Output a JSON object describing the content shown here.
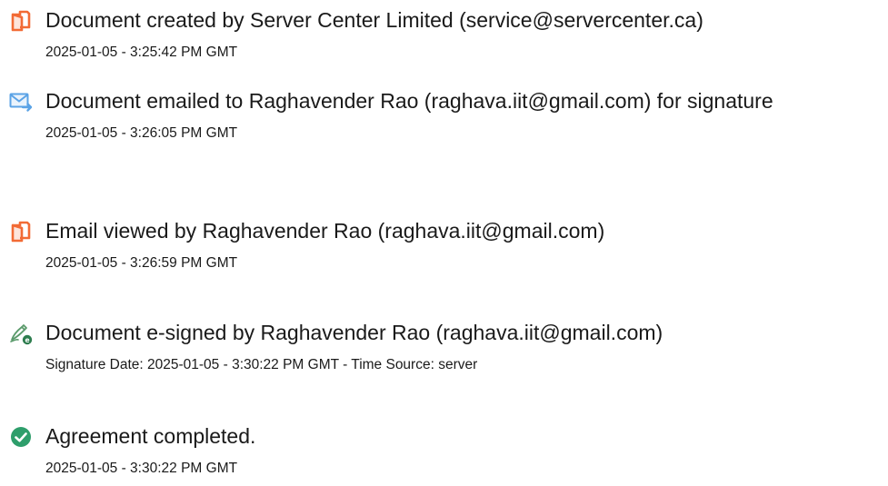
{
  "audit_trail": {
    "events": [
      {
        "icon": "document-created-icon",
        "title": "Document created by Server Center Limited (service@servercenter.ca)",
        "time": "2025-01-05 - 3:25:42 PM GMT"
      },
      {
        "icon": "email-sent-icon",
        "title": "Document emailed to Raghavender Rao (raghava.iit@gmail.com) for signature",
        "time": "2025-01-05 - 3:26:05 PM GMT"
      },
      {
        "icon": "document-viewed-icon",
        "title": "Email viewed by Raghavender Rao (raghava.iit@gmail.com)",
        "time": "2025-01-05 - 3:26:59 PM GMT"
      },
      {
        "icon": "e-sign-pen-icon",
        "title": "Document e-signed by Raghavender Rao (raghava.iit@gmail.com)",
        "time": "Signature Date: 2025-01-05 - 3:30:22 PM GMT - Time Source: server"
      },
      {
        "icon": "checkmark-circle-icon",
        "title": "Agreement completed.",
        "time": "2025-01-05 - 3:30:22 PM GMT"
      }
    ]
  },
  "colors": {
    "document_icon": "#F26B35",
    "email_icon": "#5BA3E6",
    "sign_icon": "#5A9A6B",
    "check_icon": "#2E9E6B",
    "text": "#1a1a1a"
  }
}
